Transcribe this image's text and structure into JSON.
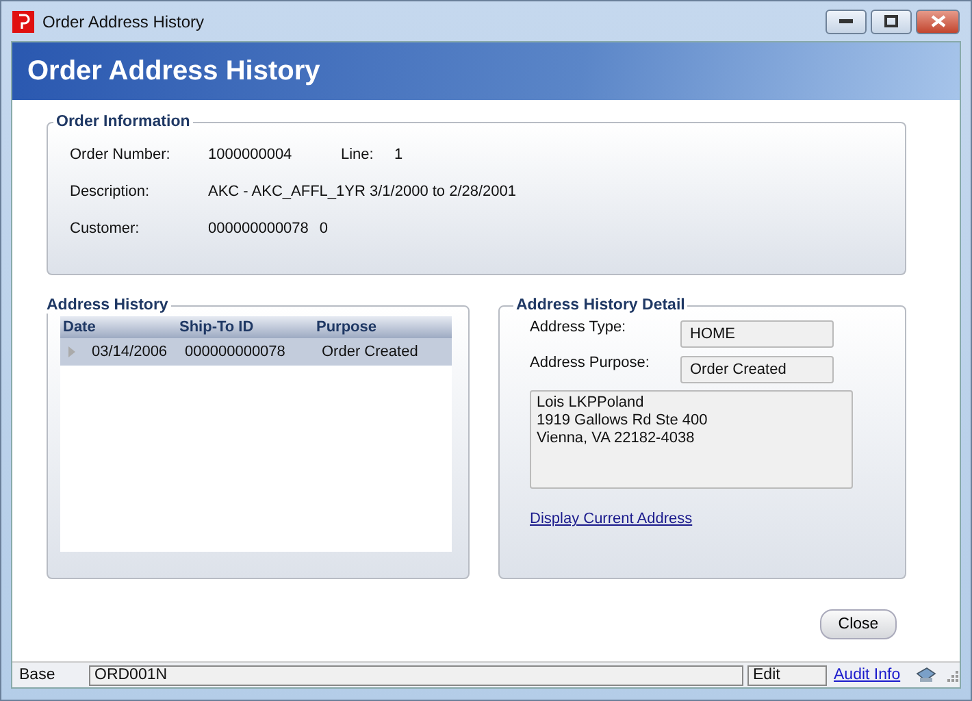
{
  "window": {
    "title": "Order Address History"
  },
  "header": {
    "title": "Order Address History"
  },
  "order_information": {
    "title": "Order Information",
    "order_number_label": "Order Number:",
    "order_number": "1000000004",
    "line_label": "Line:",
    "line": "1",
    "description_label": "Description:",
    "description": "AKC - AKC_AFFL_1YR 3/1/2000 to 2/28/2001",
    "customer_label": "Customer:",
    "customer_id": "000000000078",
    "customer_sub": "0"
  },
  "address_history": {
    "title": "Address History",
    "columns": [
      "Date",
      "Ship-To ID",
      "Purpose"
    ],
    "rows": [
      {
        "date": "03/14/2006",
        "ship_to_id": "000000000078",
        "purpose": "Order Created",
        "selected": true
      }
    ]
  },
  "address_detail": {
    "title": "Address History Detail",
    "type_label": "Address Type:",
    "type": "HOME",
    "purpose_label": "Address Purpose:",
    "purpose": "Order Created",
    "address_lines": [
      "Lois LKPPoland",
      "1919 Gallows Rd Ste 400",
      "Vienna, VA 22182-4038"
    ],
    "link": "Display Current Address"
  },
  "buttons": [
    "Close"
  ],
  "status_bar": {
    "mode": "Base",
    "form": "ORD001N",
    "state": "Edit",
    "link": "Audit Info"
  }
}
